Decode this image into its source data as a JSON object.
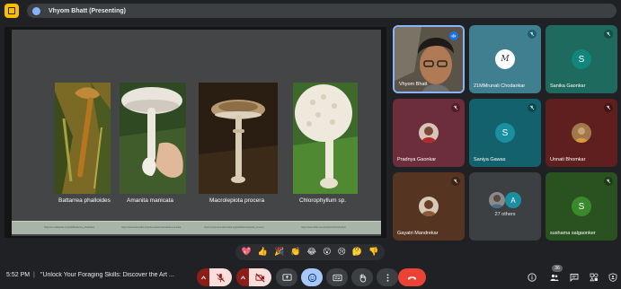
{
  "topbar": {
    "presenting_label": "Vhyom Bhatt (Presenting)"
  },
  "slide": {
    "captions": [
      "Battarrea phalloides",
      "Amanita manicata",
      "Macrolepiota procera",
      "Chlorophyllum sp."
    ],
    "credits": [
      "https://en.wikipedia.org/wiki/Battarrea_phalloides",
      "https://www.inaturalist.org/observations/amanita-manicata",
      "https://commons.wikimedia.org/wiki/Macrolepiota_procera",
      "https://www.flickr.com/photos/chlorophyllum"
    ]
  },
  "participants": [
    {
      "name": "Vhyom Bhatt",
      "type": "video",
      "initial": ""
    },
    {
      "name": "21MMrunali Chodankar",
      "type": "logo",
      "initial": "M",
      "bg": "#3f7f8f"
    },
    {
      "name": "Sanika Gaonkar",
      "type": "letter",
      "initial": "S",
      "bg": "#1e6a5e",
      "avatar": "#12857c"
    },
    {
      "name": "Pradnya Gaonkar",
      "type": "photo",
      "initial": "",
      "bg": "#6c2d3d"
    },
    {
      "name": "Saniya Gawas",
      "type": "letter",
      "initial": "S",
      "bg": "#12616c",
      "avatar": "#1a8fa0"
    },
    {
      "name": "Unnati Bhomkar",
      "type": "photo",
      "initial": "",
      "bg": "#5f1f1f"
    },
    {
      "name": "Gayatri Mandrekar",
      "type": "photo",
      "initial": "",
      "bg": "#553521"
    },
    {
      "name": "27 others",
      "type": "others",
      "initial": "A",
      "bg": "#3c4043"
    },
    {
      "name": "sushama salgaonker",
      "type": "letter",
      "initial": "S",
      "bg": "#2a5221",
      "avatar": "#3a8a2c"
    }
  ],
  "reactions": [
    "💖",
    "👍",
    "🎉",
    "👏",
    "😂",
    "😮",
    "😢",
    "🤔",
    "👎"
  ],
  "bottombar": {
    "time": "5:52 PM",
    "separator": "|",
    "meeting_title": "\"Unlock Your Foraging Skills: Discover the Art ...",
    "people_count": "36"
  },
  "colors": {
    "end_call": "#ea4335",
    "muted": "#8c1d18",
    "accent": "#8ab4f8"
  }
}
